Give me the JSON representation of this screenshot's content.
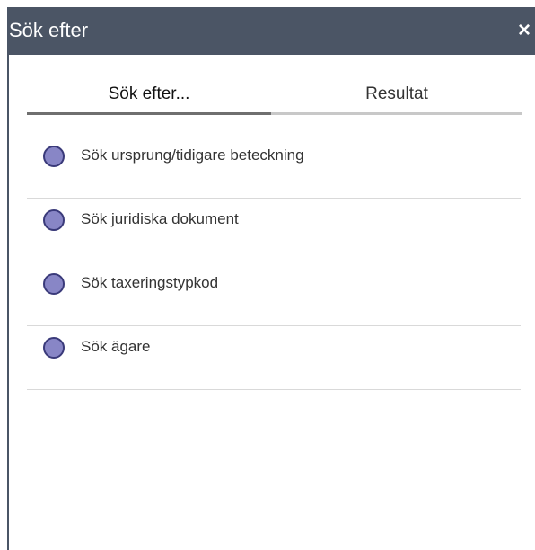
{
  "header": {
    "title": "Sök efter",
    "close_label": "×"
  },
  "tabs": [
    {
      "label": "Sök efter...",
      "active": true
    },
    {
      "label": "Resultat",
      "active": false
    }
  ],
  "options": [
    {
      "label": "Sök ursprung/tidigare beteckning"
    },
    {
      "label": "Sök juridiska dokument"
    },
    {
      "label": "Sök taxeringstypkod"
    },
    {
      "label": "Sök ägare"
    }
  ],
  "colors": {
    "header_bg": "#4b5565",
    "radio_fill": "#8886c6",
    "radio_border": "#3a3a7a"
  }
}
